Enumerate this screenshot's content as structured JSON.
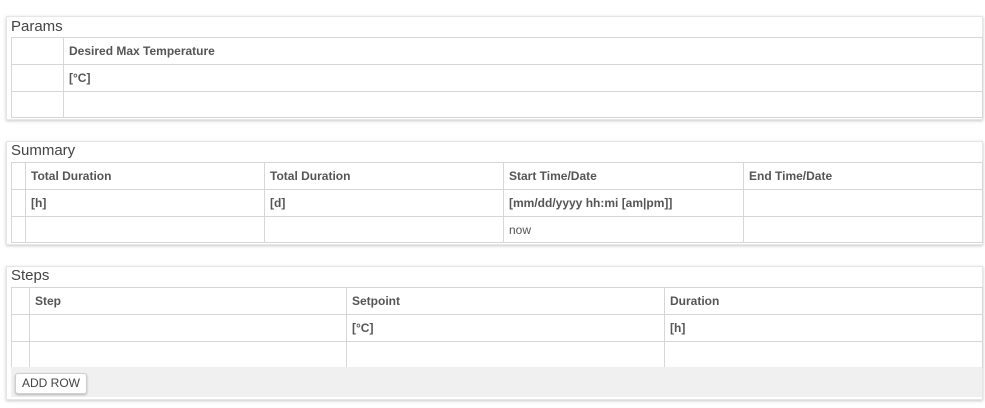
{
  "params": {
    "title": "Params",
    "column_headers": [
      "Desired Max Temperature"
    ],
    "units": [
      "[°C]"
    ],
    "values": [
      ""
    ]
  },
  "summary": {
    "title": "Summary",
    "column_headers": [
      "Total Duration",
      "Total Duration",
      "Start Time/Date",
      "End Time/Date"
    ],
    "units": [
      "[h]",
      "[d]",
      "[mm/dd/yyyy hh:mi [am|pm]]",
      ""
    ],
    "values": [
      "",
      "",
      "now",
      ""
    ]
  },
  "steps": {
    "title": "Steps",
    "column_headers": [
      "Step",
      "Setpoint",
      "Duration"
    ],
    "units": [
      "",
      "[°C]",
      "[h]"
    ],
    "values": [
      "",
      "",
      ""
    ],
    "add_row_label": "ADD ROW"
  }
}
